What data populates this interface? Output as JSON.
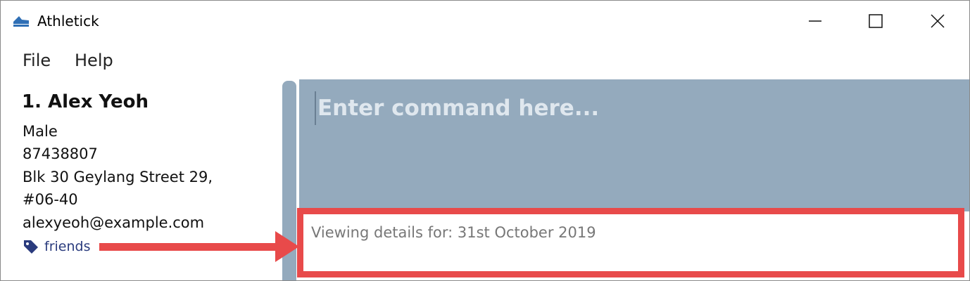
{
  "window": {
    "title": "Athletick",
    "logo_icon": "athletick-shoe-icon",
    "controls": {
      "minimize": "minimize-icon",
      "maximize": "maximize-icon",
      "close": "close-icon"
    }
  },
  "menu": {
    "file_label": "File",
    "help_label": "Help"
  },
  "person": {
    "index_name": "1.  Alex Yeoh",
    "gender": "Male",
    "phone": "87438807",
    "address_line1": "Blk 30 Geylang Street 29,",
    "address_line2": "#06-40",
    "email": "alexyeoh@example.com",
    "tag_icon": "tag-icon",
    "tag": "friends",
    "tag_color": "#2a3b7d"
  },
  "command": {
    "placeholder": "Enter command here...",
    "value": ""
  },
  "result": {
    "text": "Viewing details for: 31st October 2019"
  },
  "colors": {
    "panel": "#94aabd",
    "highlight": "#e84a4a"
  }
}
